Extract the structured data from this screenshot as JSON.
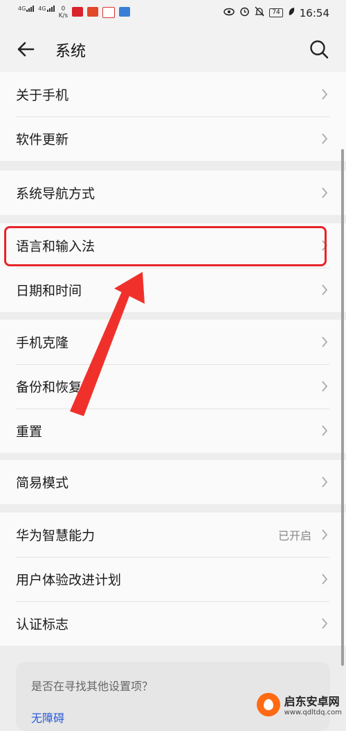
{
  "status_bar": {
    "signal_1": "4G",
    "signal_2": "4G",
    "net_speed_value": "0",
    "net_speed_unit": "K/s",
    "battery": "74",
    "time": "16:54"
  },
  "header": {
    "title": "系统"
  },
  "groups": [
    {
      "items": [
        {
          "label": "关于手机"
        },
        {
          "label": "软件更新"
        }
      ]
    },
    {
      "items": [
        {
          "label": "系统导航方式"
        }
      ]
    },
    {
      "items": [
        {
          "label": "语言和输入法"
        },
        {
          "label": "日期和时间"
        }
      ]
    },
    {
      "items": [
        {
          "label": "手机克隆"
        },
        {
          "label": "备份和恢复"
        },
        {
          "label": "重置"
        }
      ]
    },
    {
      "items": [
        {
          "label": "简易模式"
        }
      ]
    },
    {
      "items": [
        {
          "label": "华为智慧能力",
          "value": "已开启"
        },
        {
          "label": "用户体验改进计划"
        },
        {
          "label": "认证标志"
        }
      ]
    }
  ],
  "suggestion": {
    "question": "是否在寻找其他设置项？",
    "link": "无障碍"
  },
  "watermark": {
    "name": "启东安卓网",
    "url": "www.qdltdq.com"
  },
  "colors": {
    "highlight": "#e8232a",
    "link": "#2a5bd7"
  }
}
